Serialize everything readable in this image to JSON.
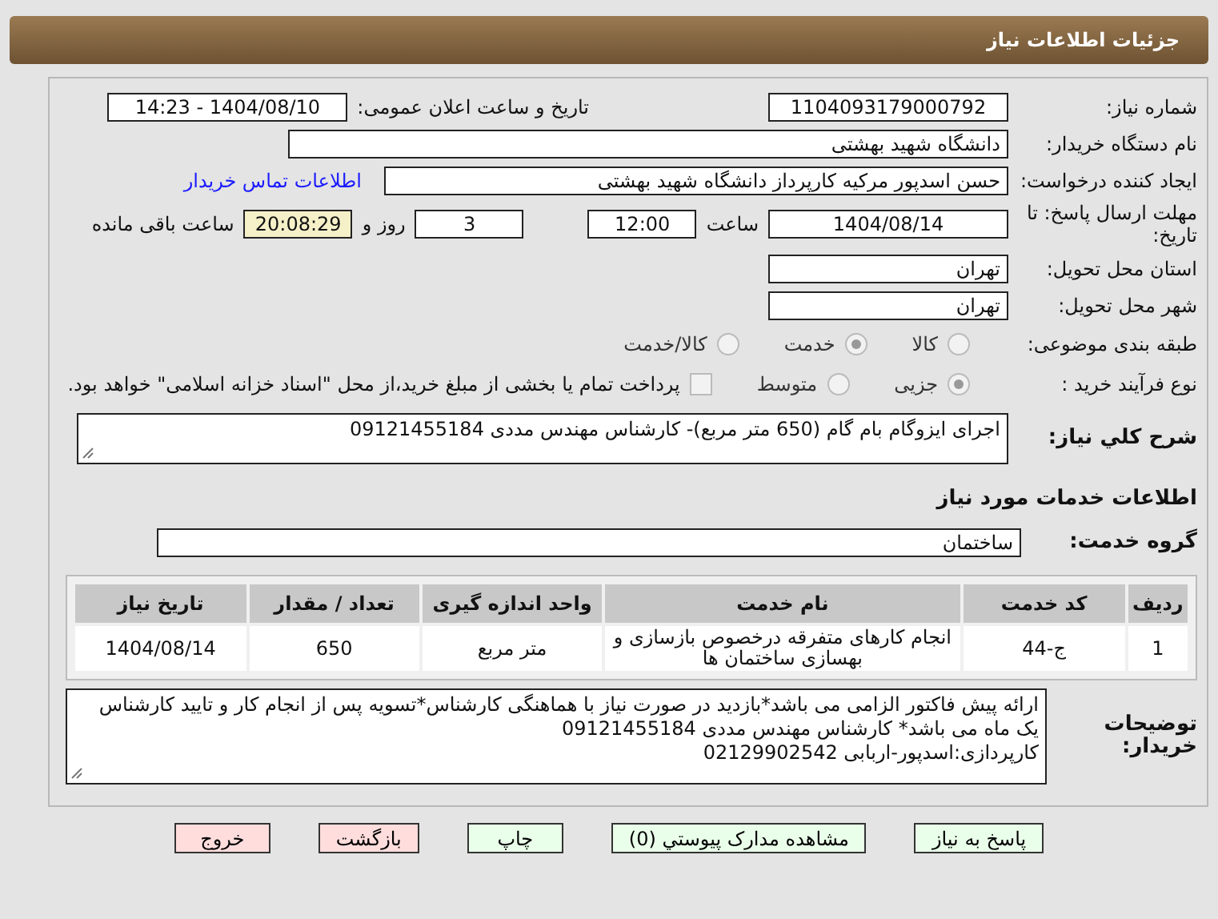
{
  "header": {
    "title": "جزئیات اطلاعات نیاز"
  },
  "fields": {
    "need_number": {
      "label": "شماره نیاز:",
      "value": "1104093179000792"
    },
    "announce": {
      "label": "تاریخ و ساعت اعلان عمومی:",
      "value": "1404/08/10 - 14:23"
    },
    "buyer": {
      "label": "نام دستگاه خریدار:",
      "value": "دانشگاه شهید بهشتی"
    },
    "requester": {
      "label": "ایجاد کننده درخواست:",
      "value": "حسن اسدپور مرکیه کارپرداز دانشگاه شهید بهشتی",
      "link": "اطلاعات تماس خریدار"
    },
    "deadline": {
      "label": "مهلت ارسال پاسخ: تا تاریخ:",
      "date": "1404/08/14",
      "time_label": "ساعت",
      "time": "12:00",
      "days": "3",
      "days_label": "روز و",
      "remaining": "20:08:29",
      "remaining_label": "ساعت باقی مانده"
    },
    "province": {
      "label": "استان محل تحویل:",
      "value": "تهران"
    },
    "city": {
      "label": "شهر محل تحویل:",
      "value": "تهران"
    }
  },
  "category": {
    "label": "طبقه بندی موضوعی:",
    "options": [
      {
        "label": "کالا",
        "selected": false
      },
      {
        "label": "خدمت",
        "selected": true
      },
      {
        "label": "کالا/خدمت",
        "selected": false
      }
    ]
  },
  "process": {
    "label": "نوع فرآیند خرید :",
    "options": [
      {
        "label": "جزیی",
        "selected": true
      },
      {
        "label": "متوسط",
        "selected": false
      }
    ],
    "payment": {
      "checked": false,
      "label": "پرداخت تمام یا بخشی از مبلغ خرید،از محل \"اسناد خزانه اسلامی\" خواهد بود."
    }
  },
  "summary": {
    "label": "شرح کلي نیاز:",
    "value": "اجرای ایزوگام بام گام (650 متر مربع)- کارشناس مهندس مددی 09121455184"
  },
  "services_heading": "اطلاعات خدمات مورد نیاز",
  "service_group": {
    "label": "گروه خدمت:",
    "value": "ساختمان"
  },
  "table": {
    "columns": [
      "ردیف",
      "کد خدمت",
      "نام خدمت",
      "واحد اندازه گیری",
      "تعداد / مقدار",
      "تاریخ نیاز"
    ],
    "rows": [
      [
        "1",
        "ج-44",
        "انجام کارهای متفرقه درخصوص بازسازی و بهسازی ساختمان ها",
        "متر مربع",
        "650",
        "1404/08/14"
      ]
    ]
  },
  "description": {
    "label": "توضیحات خریدار:",
    "value": "ارائه پیش فاکتور الزامی می باشد*بازدید در صورت نیاز با هماهنگی کارشناس*تسویه پس از انجام کار و تایید کارشناس یک ماه می باشد* کارشناس مهندس مددی 09121455184\nکارپردازی:اسدپور-اربابی 02129902542"
  },
  "buttons": [
    {
      "label": "پاسخ به نیاز",
      "kind": "normal"
    },
    {
      "label": "مشاهده مدارک پیوستي (0)",
      "kind": "normal"
    },
    {
      "label": "چاپ",
      "kind": "normal"
    },
    {
      "label": "بازگشت",
      "kind": "danger"
    },
    {
      "label": "خروج",
      "kind": "danger"
    }
  ]
}
